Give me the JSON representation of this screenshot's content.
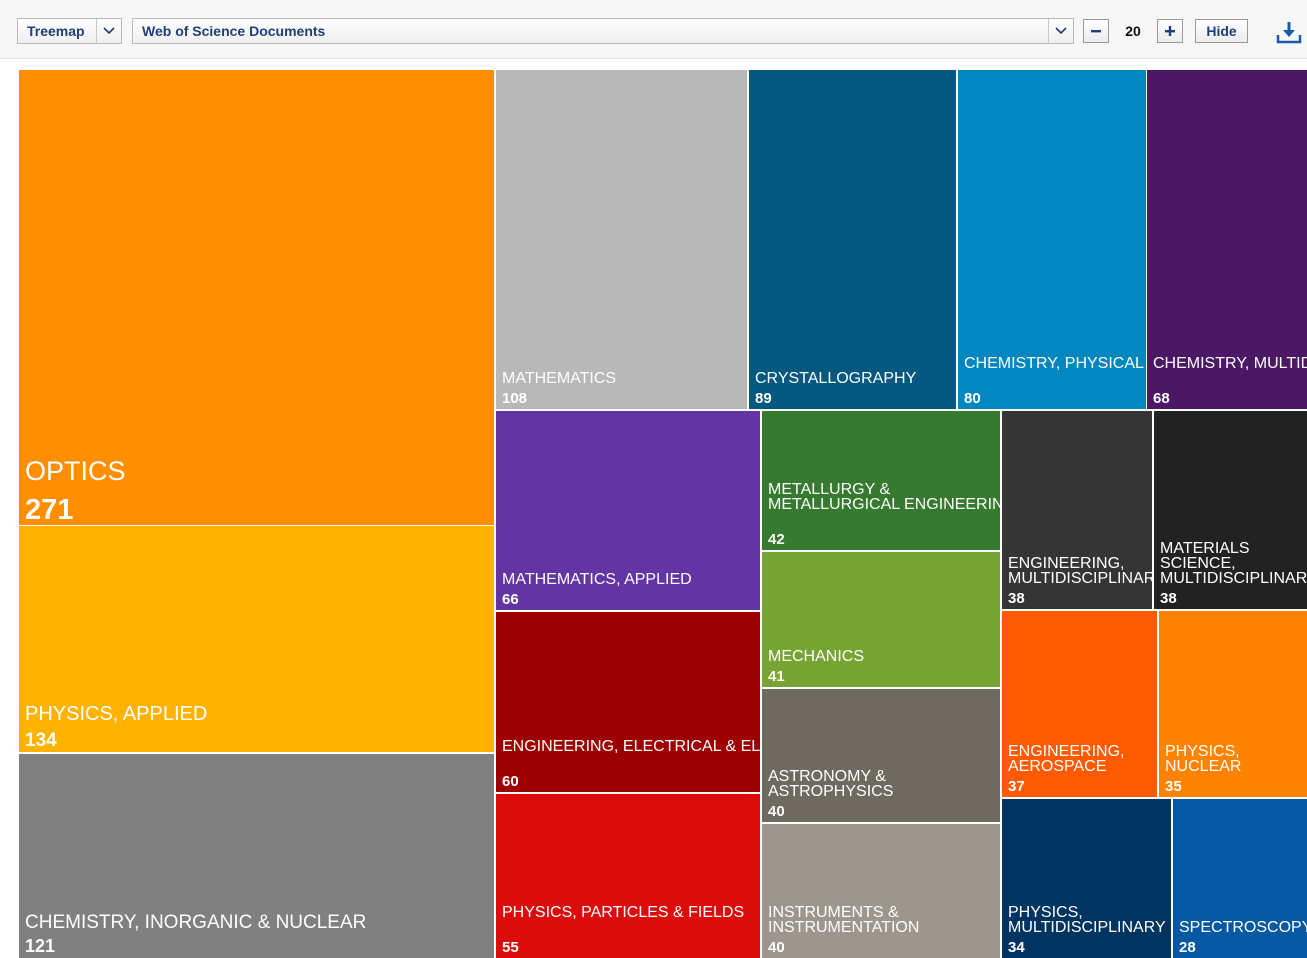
{
  "toolbar": {
    "viz_type": "Treemap",
    "field": "Web of Science Documents",
    "count": "20",
    "decrement_icon": "minus-icon",
    "increment_icon": "plus-icon",
    "hide_label": "Hide",
    "download_icon": "download-icon"
  },
  "colors": {
    "toolbar_text": "#1f3f7a",
    "download_icon": "#1a5ba8"
  },
  "chart_data": {
    "type": "treemap",
    "title": "",
    "categories": [
      "OPTICS",
      "PHYSICS, APPLIED",
      "CHEMISTRY, INORGANIC & NUCLEAR",
      "MATHEMATICS",
      "CRYSTALLOGRAPHY",
      "CHEMISTRY, PHYSICAL",
      "CHEMISTRY, MULTIDISCIPLINARY",
      "MATHEMATICS, APPLIED",
      "ENGINEERING, ELECTRICAL & ELECTRONIC",
      "PHYSICS, PARTICLES & FIELDS",
      "METALLURGY & METALLURGICAL ENGINEERING",
      "MECHANICS",
      "ASTRONOMY & ASTROPHYSICS",
      "INSTRUMENTS & INSTRUMENTATION",
      "ENGINEERING, MULTIDISCIPLINARY",
      "MATERIALS SCIENCE, MULTIDISCIPLINARY",
      "ENGINEERING, AEROSPACE",
      "PHYSICS, NUCLEAR",
      "PHYSICS, MULTIDISCIPLINARY",
      "SPECTROSCOPY"
    ],
    "values": [
      271,
      134,
      121,
      108,
      89,
      80,
      68,
      66,
      60,
      55,
      42,
      41,
      40,
      40,
      38,
      38,
      37,
      35,
      34,
      28
    ],
    "colors": [
      "#ff8f00",
      "#ffb300",
      "#808080",
      "#b8b8b8",
      "#02587f",
      "#0087c0",
      "#4b1866",
      "#6334a3",
      "#9d0000",
      "#dd0c0c",
      "#367a2f",
      "#77a433",
      "#6f6a60",
      "#9d968d",
      "#353535",
      "#222222",
      "#ff5a00",
      "#ff8300",
      "#003460",
      "#0558a1"
    ]
  }
}
